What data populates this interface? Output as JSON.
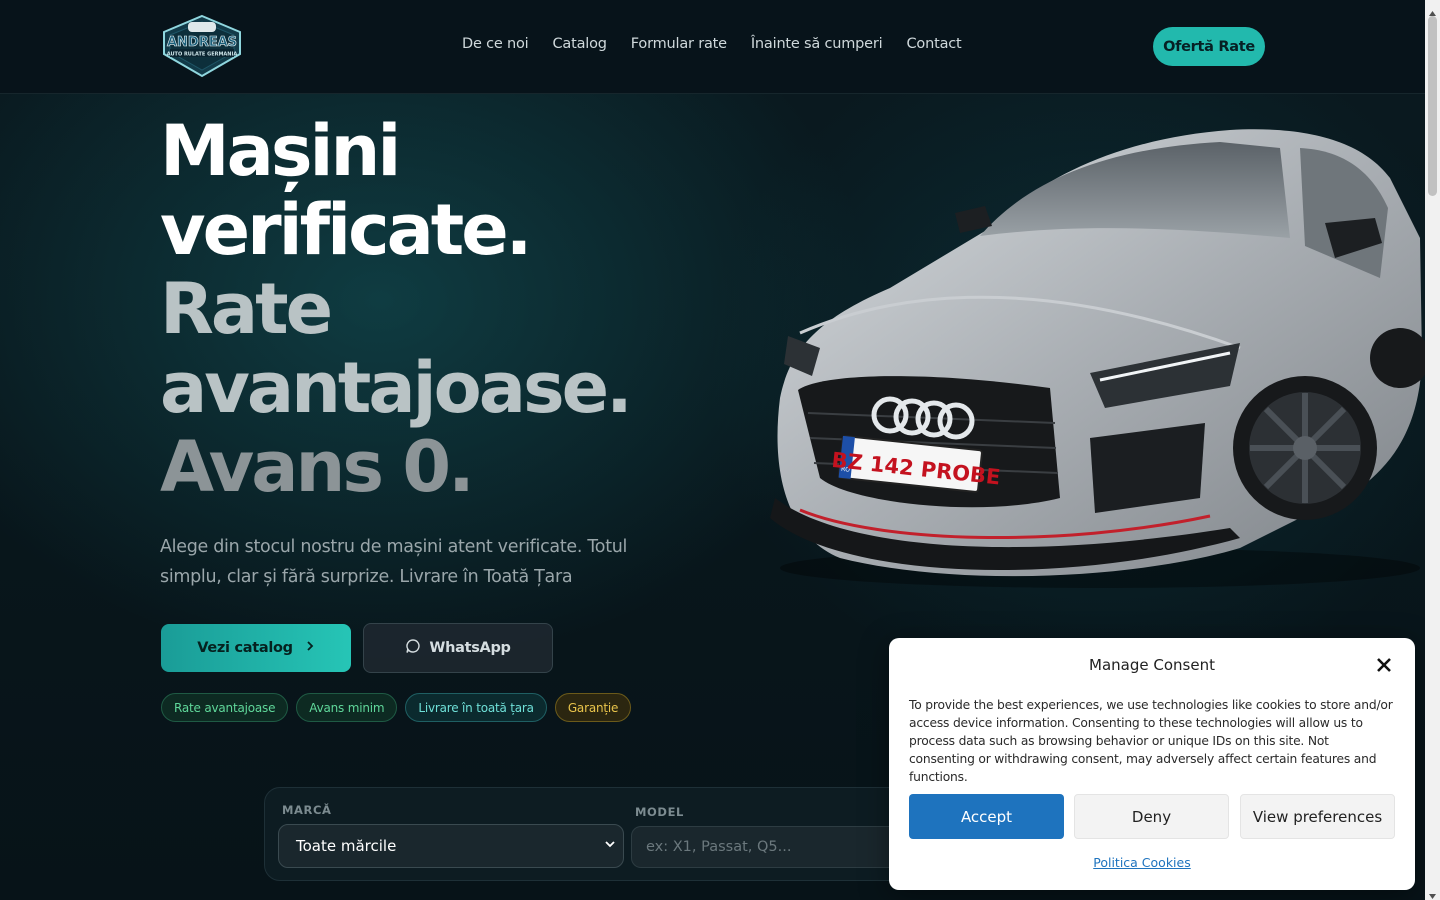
{
  "header": {
    "logo_text": "ANDREAS",
    "logo_subtext": "AUTO RULATE GERMANIA",
    "nav": [
      "De ce noi",
      "Catalog",
      "Formular rate",
      "Înainte să cumperi",
      "Contact"
    ],
    "cta_label": "Ofertă Rate"
  },
  "hero": {
    "line1": "Mașini",
    "line2": "verificate.",
    "line3": "Rate",
    "line4": "avantajoase.",
    "line5": "Avans 0.",
    "subtitle": "Alege din stocul nostru de mașini atent verificate. Totul simplu, clar și fără surprize. Livrare în Toată Țara",
    "btn_catalog": "Vezi catalog",
    "btn_whatsapp": "WhatsApp",
    "tags": [
      "Rate avantajoase",
      "Avans minim",
      "Livrare în toată țara",
      "Garanție"
    ],
    "plate": "BZ 142 PROBE",
    "plate_country": "RO"
  },
  "search": {
    "brand_label": "MARCĂ",
    "brand_value": "Toate mărcile",
    "model_label": "MODEL",
    "model_placeholder": "ex: X1, Passat, Q5..."
  },
  "consent": {
    "title": "Manage Consent",
    "text": "To provide the best experiences, we use technologies like cookies to store and/or access device information. Consenting to these technologies will allow us to process data such as browsing behavior or unique IDs on this site. Not consenting or withdrawing consent, may adversely affect certain features and functions.",
    "accept": "Accept",
    "deny": "Deny",
    "preferences": "View preferences",
    "policy_link": "Politica Cookies"
  },
  "colors": {
    "accent": "#22b9ad",
    "consent_accept": "#1e73be",
    "background": "#07141a"
  }
}
